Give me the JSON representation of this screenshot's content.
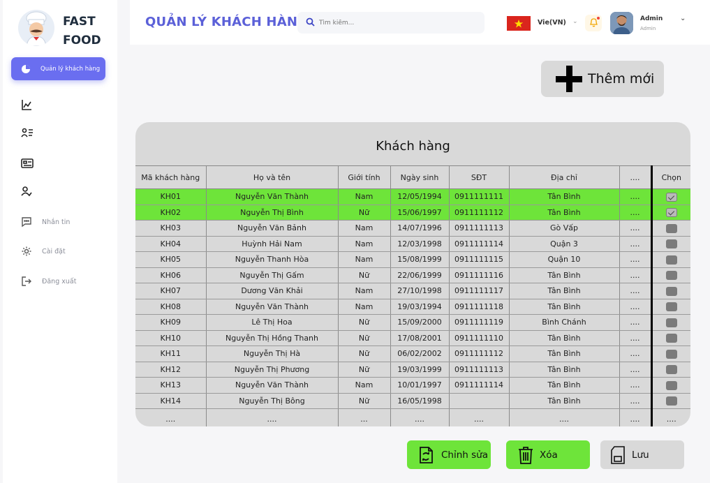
{
  "brand": {
    "line1": "FAST",
    "line2": "FOOD"
  },
  "sidebar": {
    "active_label": "Quản lý khách hàng",
    "items": [
      {
        "label": "Nhắn tin"
      },
      {
        "label": "Cài đặt"
      },
      {
        "label": "Đăng xuất"
      }
    ]
  },
  "header": {
    "title": "QUẢN LÝ KHÁCH HÀNG",
    "search_placeholder": "Tìm kiếm...",
    "language": "Vie(VN)",
    "user_name": "Admin",
    "user_role": "Admin"
  },
  "add_button": {
    "label": "Thêm mới"
  },
  "table": {
    "title": "Khách hàng",
    "columns": [
      "Mã khách hàng",
      "Họ và tên",
      "Giới tính",
      "Ngày sinh",
      "SĐT",
      "Địa chỉ",
      "....",
      "Chọn"
    ],
    "rows": [
      {
        "id": "KH01",
        "name": "Nguyễn Văn Thành",
        "gender": "Nam",
        "dob": "12/05/1994",
        "phone": "0911111111",
        "address": "Tân Bình",
        "more": "....",
        "checked": true
      },
      {
        "id": "KH02",
        "name": "Nguyễn Thị Bình",
        "gender": "Nữ",
        "dob": "15/06/1997",
        "phone": "0911111112",
        "address": "Tân Bình",
        "more": "....",
        "checked": true
      },
      {
        "id": "KH03",
        "name": "Nguyễn Văn Bảnh",
        "gender": "Nam",
        "dob": "14/07/1996",
        "phone": "0911111113",
        "address": "Gò Vấp",
        "more": "....",
        "checked": false
      },
      {
        "id": "KH04",
        "name": "Huỳnh Hải Nam",
        "gender": "Nam",
        "dob": "12/03/1998",
        "phone": "0911111114",
        "address": "Quận 3",
        "more": "....",
        "checked": false
      },
      {
        "id": "KH05",
        "name": "Nguyễn Thanh Hòa",
        "gender": "Nam",
        "dob": "15/08/1999",
        "phone": "0911111115",
        "address": "Quận 10",
        "more": "....",
        "checked": false
      },
      {
        "id": "KH06",
        "name": "Nguyễn Thị Gấm",
        "gender": "Nữ",
        "dob": "22/06/1999",
        "phone": "0911111116",
        "address": "Tân Bình",
        "more": "....",
        "checked": false
      },
      {
        "id": "KH07",
        "name": "Dương Văn Khải",
        "gender": "Nam",
        "dob": "27/10/1998",
        "phone": "0911111117",
        "address": "Tân Bình",
        "more": "....",
        "checked": false
      },
      {
        "id": "KH08",
        "name": "Nguyễn Văn Thành",
        "gender": "Nam",
        "dob": "19/03/1994",
        "phone": "0911111118",
        "address": "Tân Bình",
        "more": "....",
        "checked": false
      },
      {
        "id": "KH09",
        "name": "Lê Thị Hoa",
        "gender": "Nữ",
        "dob": "15/09/2000",
        "phone": "0911111119",
        "address": "Bình Chánh",
        "more": "....",
        "checked": false
      },
      {
        "id": "KH10",
        "name": "Nguyễn Thị Hồng Thanh",
        "gender": "Nữ",
        "dob": "17/08/2001",
        "phone": "0911111110",
        "address": "Tân Bình",
        "more": "....",
        "checked": false
      },
      {
        "id": "KH11",
        "name": "Nguyễn Thị Hà",
        "gender": "Nữ",
        "dob": "06/02/2002",
        "phone": "0911111112",
        "address": "Tân Bình",
        "more": "....",
        "checked": false
      },
      {
        "id": "KH12",
        "name": "Nguyễn Thị Phương",
        "gender": "Nữ",
        "dob": "19/03/1999",
        "phone": "0911111113",
        "address": "Tân Bình",
        "more": "....",
        "checked": false
      },
      {
        "id": "KH13",
        "name": "Nguyễn Văn Thành",
        "gender": "Nam",
        "dob": "10/01/1997",
        "phone": "0911111114",
        "address": "Tân Bình",
        "more": "....",
        "checked": false
      },
      {
        "id": "KH14",
        "name": "Nguyễn Thị Bông",
        "gender": "Nữ",
        "dob": "16/05/1998",
        "phone": "",
        "address": "Tân Bình",
        "more": "....",
        "checked": false
      },
      {
        "id": "....",
        "name": "....",
        "gender": "...",
        "dob": "....",
        "phone": "....",
        "address": "....",
        "more": "....",
        "checked": null,
        "select_text": "...."
      }
    ]
  },
  "actions": {
    "edit": "Chỉnh sửa",
    "delete": "Xóa",
    "save": "Lưu"
  },
  "colors": {
    "accent": "#5b60d8",
    "active_nav": "#6a6ef0",
    "selected_row": "#6ee43a",
    "panel": "#d9d9d9"
  }
}
